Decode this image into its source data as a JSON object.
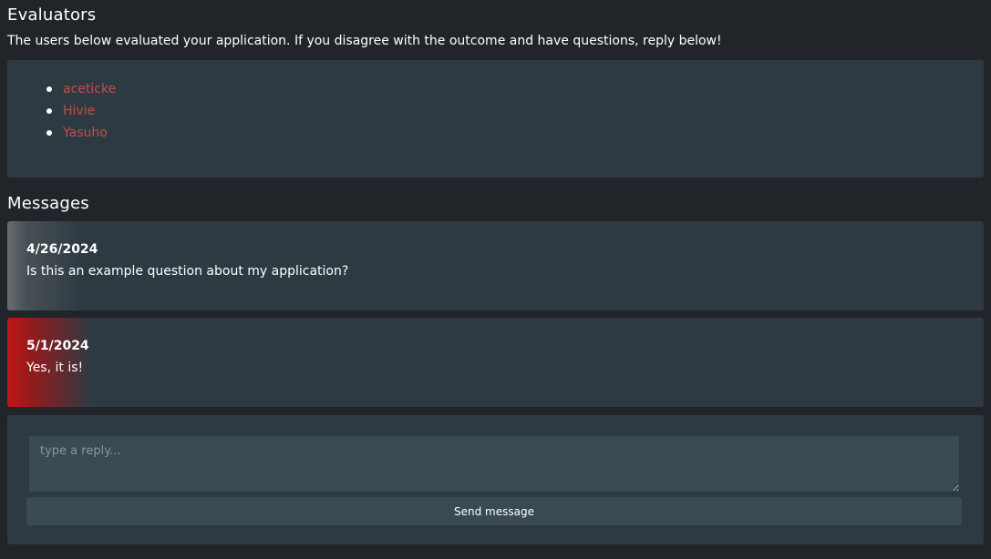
{
  "evaluators": {
    "heading": "Evaluators",
    "intro": "The users below evaluated your application. If you disagree with the outcome and have questions, reply below!",
    "users": [
      {
        "name": "aceticke"
      },
      {
        "name": "Hivie"
      },
      {
        "name": "Yasuho"
      }
    ],
    "link_color": "#c0504a"
  },
  "messages": {
    "heading": "Messages",
    "items": [
      {
        "date": "4/26/2024",
        "text": "Is this an example question about my application?",
        "accent": "grey"
      },
      {
        "date": "5/1/2024",
        "text": "Yes, it is!",
        "accent": "red"
      }
    ]
  },
  "reply": {
    "placeholder": "type a reply...",
    "value": "",
    "send_label": "Send message"
  },
  "colors": {
    "background": "#212529",
    "panel": "#2d3a42",
    "input": "#3a4a53",
    "accent_red": "#c81414"
  }
}
